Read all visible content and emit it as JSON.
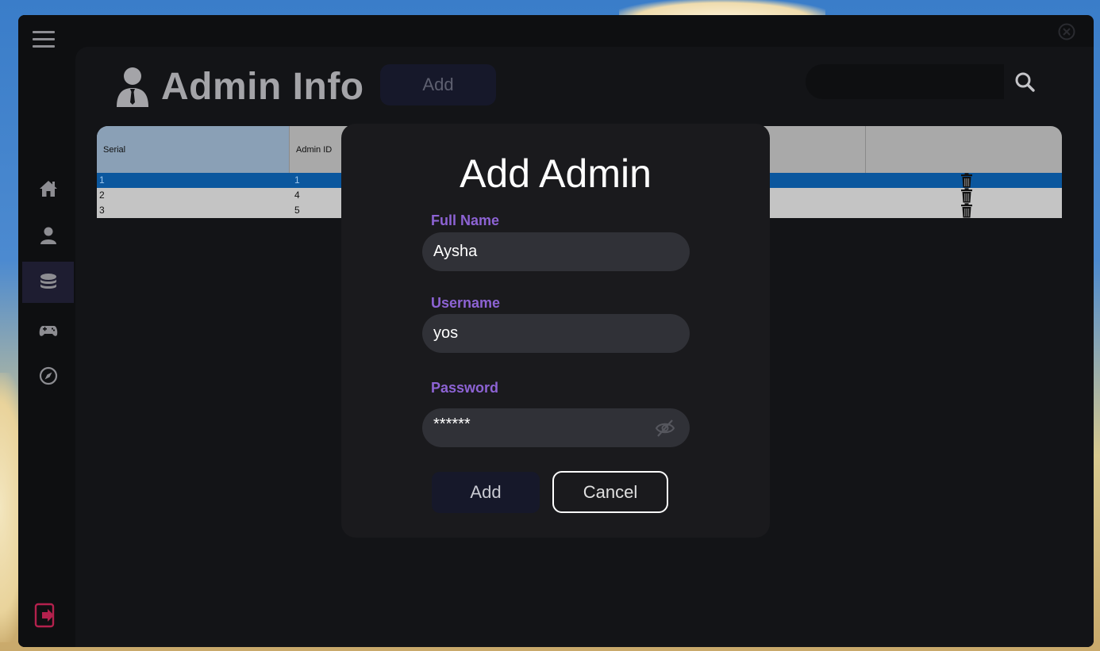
{
  "header": {
    "title": "Admin Info",
    "add_label": "Add"
  },
  "search": {
    "placeholder": "",
    "value": ""
  },
  "sidebar": {
    "items": [
      {
        "icon": "home-icon"
      },
      {
        "icon": "user-icon"
      },
      {
        "icon": "database-icon",
        "active": true
      },
      {
        "icon": "gamepad-icon"
      },
      {
        "icon": "compass-icon"
      }
    ]
  },
  "table": {
    "columns": [
      "Serial",
      "Admin ID",
      ""
    ],
    "rows": [
      {
        "serial": "1",
        "admin_id": "1",
        "selected": true
      },
      {
        "serial": "2",
        "admin_id": "4",
        "selected": false
      },
      {
        "serial": "3",
        "admin_id": "5",
        "selected": false
      }
    ]
  },
  "modal": {
    "title": "Add Admin",
    "fullname_label": "Full Name",
    "fullname_value": "Aysha",
    "username_label": "Username",
    "username_value": "yos",
    "password_label": "Password",
    "password_value": "******",
    "add_label": "Add",
    "cancel_label": "Cancel"
  },
  "colors": {
    "accent_purple": "#8d63d4",
    "selected_row": "#0b579e",
    "logout": "#b3214d"
  }
}
